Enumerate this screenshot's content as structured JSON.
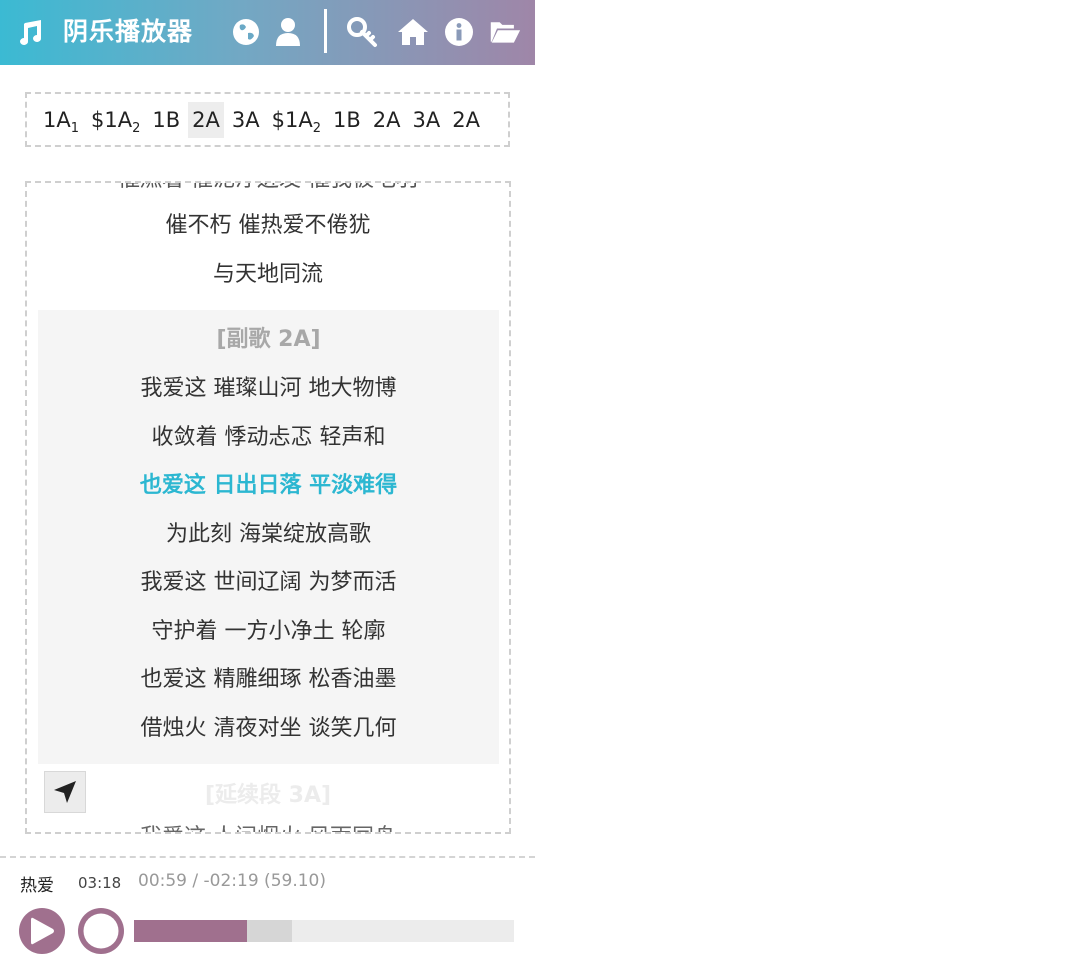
{
  "app": {
    "title": "阴乐播放器",
    "icons": [
      "music-note-icon",
      "globe-icon",
      "user-icon",
      "key-icon",
      "home-icon",
      "info-icon",
      "folder-open-icon"
    ],
    "colors": {
      "gradient_start": "#3bbad3",
      "gradient_end": "#9f86a8",
      "accent": "#2cb7d1",
      "progress": "#a0708e"
    }
  },
  "sections": [
    {
      "main": "1A",
      "sub": "1"
    },
    {
      "main": "$1A",
      "sub": "2"
    },
    {
      "main": "1B",
      "sub": ""
    },
    {
      "main": "2A",
      "sub": "",
      "active": true
    },
    {
      "main": "3A",
      "sub": ""
    },
    {
      "main": "$1A",
      "sub": "2"
    },
    {
      "main": "1B",
      "sub": ""
    },
    {
      "main": "2A",
      "sub": ""
    },
    {
      "main": "3A",
      "sub": ""
    },
    {
      "main": "2A",
      "sub": ""
    }
  ],
  "lyrics": {
    "cut_top": "催燃着 催泥泞迸发 催我被毛羽",
    "before": [
      "催不朽 催热爱不倦犹",
      "与天地同流"
    ],
    "chorus_title": "[副歌 2A]",
    "chorus": [
      "我爱这 璀璨山河 地大物博",
      "收敛着 悸动忐忑 轻声和",
      "也爱这 日出日落 平淡难得",
      "为此刻 海棠绽放高歌",
      "我爱这 世间辽阔 为梦而活",
      "守护着 一方小净土 轮廓",
      "也爱这 精雕细琢 松香油墨",
      "借烛火 清夜对坐 谈笑几何"
    ],
    "current_index": 2,
    "next_title": "[延续段 3A]",
    "cut_bottom": "我爱这 人间烟火 风雨同舟"
  },
  "player": {
    "song": "热爱",
    "duration": "03:18",
    "time": "00:59 / -02:19 (59.10)",
    "progress_fraction": 0.298,
    "buffered_fraction": 0.415
  }
}
